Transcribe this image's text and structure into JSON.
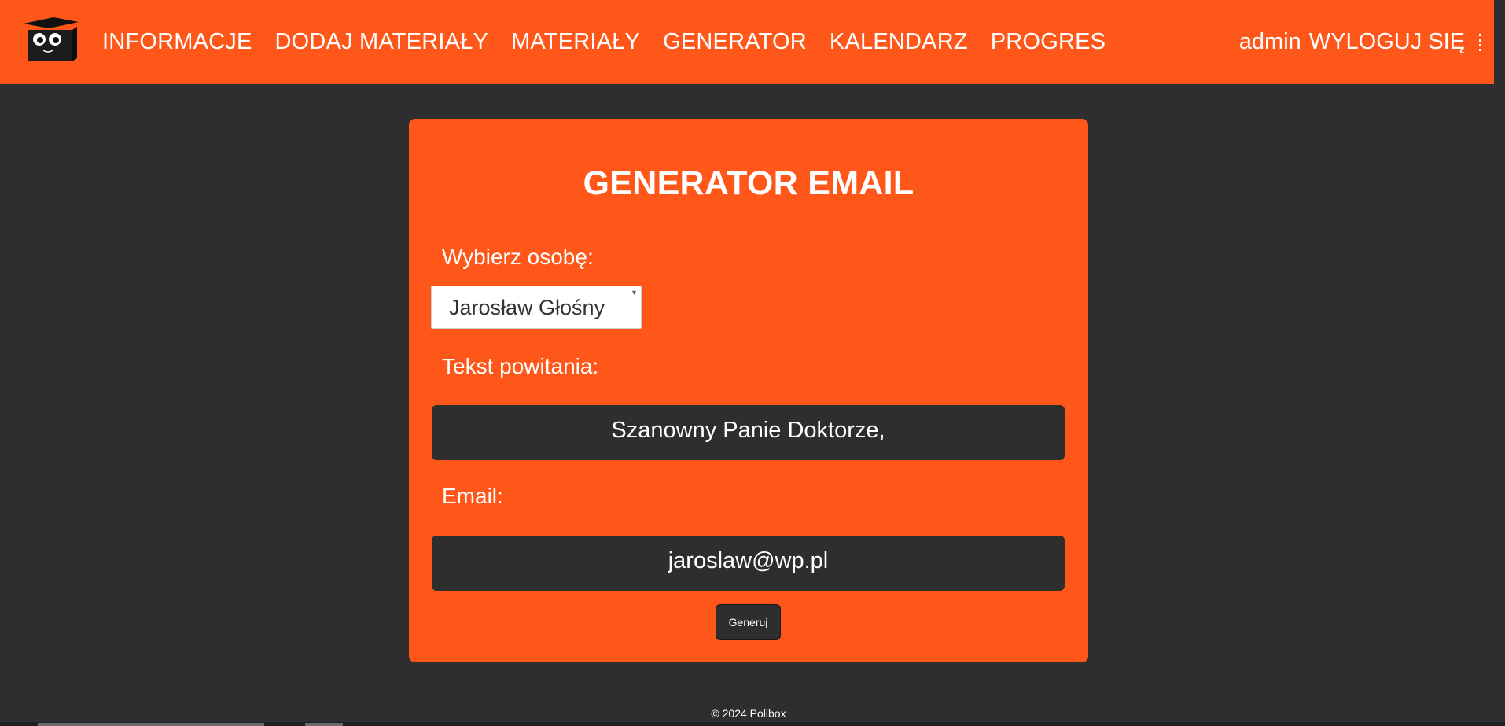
{
  "nav": {
    "logo_icon": "owl-graduate-icon",
    "items": [
      {
        "label": "INFORMACJE"
      },
      {
        "label": "DODAJ MATERIAŁY"
      },
      {
        "label": "MATERIAŁY"
      },
      {
        "label": "GENERATOR"
      },
      {
        "label": "KALENDARZ"
      },
      {
        "label": "PROGRES"
      }
    ],
    "user": "admin",
    "logout_label": "WYLOGUJ SIĘ"
  },
  "generator": {
    "title": "GENERATOR EMAIL",
    "person_label": "Wybierz osobę:",
    "person_selected": "Jarosław Głośny",
    "greeting_label": "Tekst powitania:",
    "greeting_value": "Szanowny Panie Doktorze,",
    "email_label": "Email:",
    "email_value": "jaroslaw@wp.pl",
    "generate_label": "Generuj"
  },
  "footer": {
    "text": "© 2024 Polibox"
  },
  "colors": {
    "accent": "#ff5719",
    "background": "#2e2e2e",
    "text": "#ffffff"
  }
}
